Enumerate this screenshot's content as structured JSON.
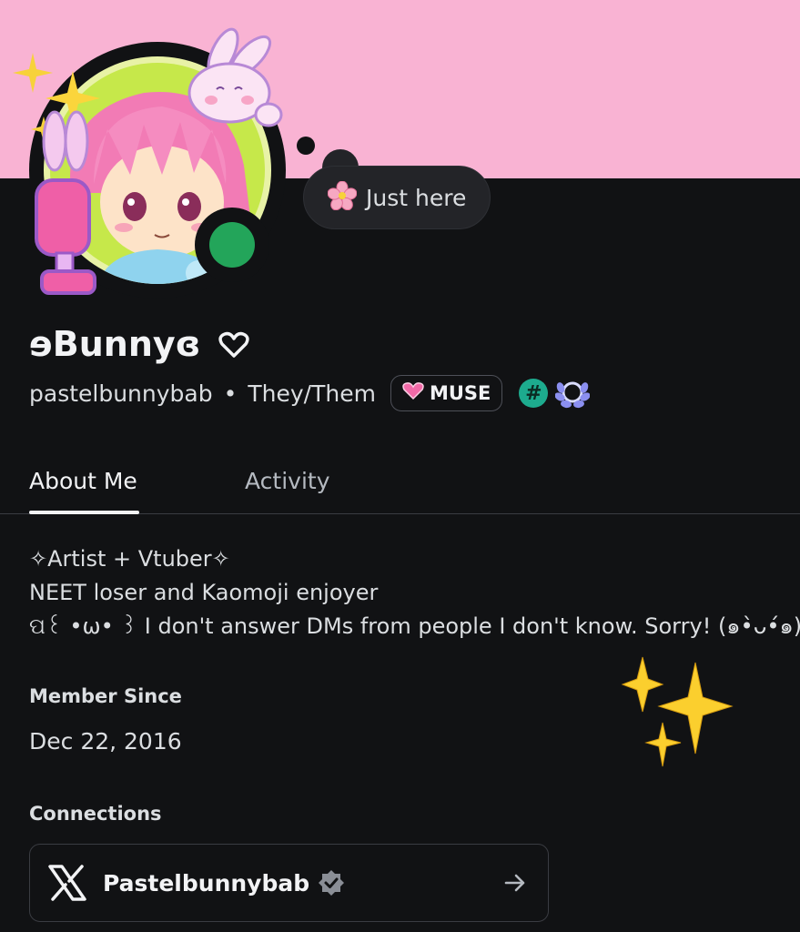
{
  "profile": {
    "display_name": "ɘBunnyɞ",
    "username": "pastelbunnybab",
    "separator": "•",
    "pronouns": "They/Them",
    "status_text": "Just here",
    "muse_badge": "MUSE",
    "hash_badge": "#",
    "online_status_color": "#23a55a",
    "banner_color": "#f9b3d3"
  },
  "tabs": [
    {
      "label": "About Me",
      "active": true
    },
    {
      "label": "Activity",
      "active": false
    }
  ],
  "bio": {
    "lines": [
      "✧Artist + Vtuber✧",
      "NEET loser and Kaomoji enjoyer",
      "ପ꒰ •ω• ꒱ I don't answer DMs from people I don't know. Sorry! (๑•̀ᴗ•́๑)"
    ]
  },
  "member_since": {
    "label": "Member Since",
    "date": "Dec 22, 2016"
  },
  "connections": {
    "label": "Connections",
    "items": [
      {
        "platform_icon": "x-logo-icon",
        "name": "Pastelbunnybab",
        "verified": true
      }
    ]
  }
}
